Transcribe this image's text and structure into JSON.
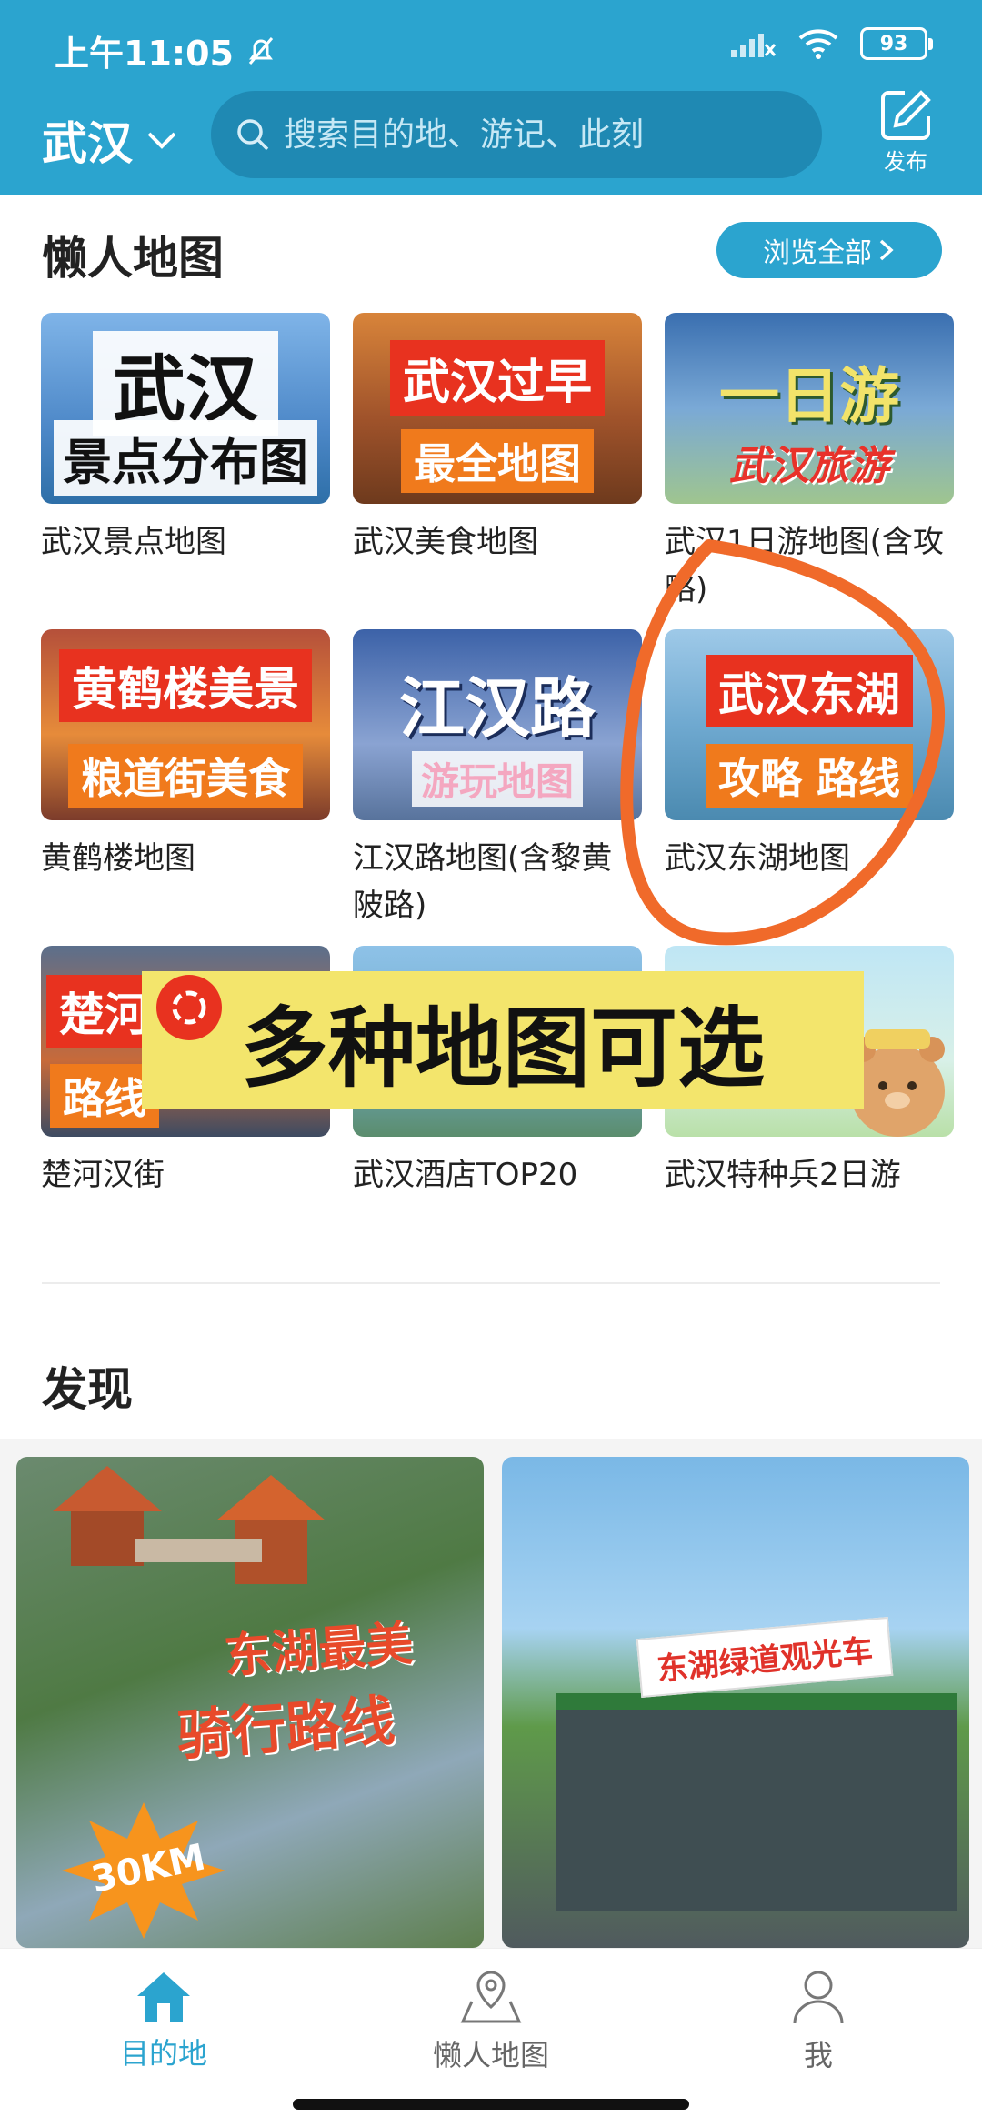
{
  "status_bar": {
    "time": "上午11:05",
    "battery": "93"
  },
  "header": {
    "city": "武汉",
    "search_placeholder": "搜索目的地、游记、此刻",
    "publish_label": "发布"
  },
  "lazy_maps": {
    "title": "懒人地图",
    "browse_all": "浏览全部",
    "cards": [
      {
        "caption": "武汉景点地图",
        "thumb_lines": [
          "武汉",
          "景点分布图"
        ]
      },
      {
        "caption": "武汉美食地图",
        "thumb_lines": [
          "武汉过早",
          "最全地图"
        ]
      },
      {
        "caption": "武汉1日游地图(含攻略)",
        "thumb_lines": [
          "一日游",
          "武汉旅游"
        ]
      },
      {
        "caption": "黄鹤楼地图",
        "thumb_lines": [
          "黄鹤楼美景",
          "粮道街美食"
        ]
      },
      {
        "caption": "江汉路地图(含黎黄陂路)",
        "thumb_lines": [
          "江汉路",
          "游玩地图"
        ]
      },
      {
        "caption": "武汉东湖地图",
        "thumb_lines": [
          "武汉东湖",
          "攻略 路线"
        ]
      },
      {
        "caption": "楚河汉街",
        "thumb_lines": [
          "楚河",
          "路线"
        ]
      },
      {
        "caption": "武汉酒店TOP20",
        "thumb_lines": [
          "",
          ""
        ]
      },
      {
        "caption": "武汉特种兵2日游",
        "thumb_lines": [
          "",
          ""
        ]
      }
    ]
  },
  "overlay_text": "多种地图可选",
  "discover": {
    "title": "发现",
    "feed": [
      {
        "line1": "东湖最美",
        "line2": "骑行路线",
        "badge": "30KM"
      },
      {
        "sign": "东湖绿道观光车"
      }
    ]
  },
  "bottom_nav": [
    {
      "label": "目的地",
      "icon": "home-icon",
      "active": true
    },
    {
      "label": "懒人地图",
      "icon": "map-pin-icon",
      "active": false
    },
    {
      "label": "我",
      "icon": "person-icon",
      "active": false
    }
  ],
  "colors": {
    "primary": "#2ba4cf",
    "annotation_circle": "#f06a2a",
    "overlay_bg": "#f3e56c"
  }
}
